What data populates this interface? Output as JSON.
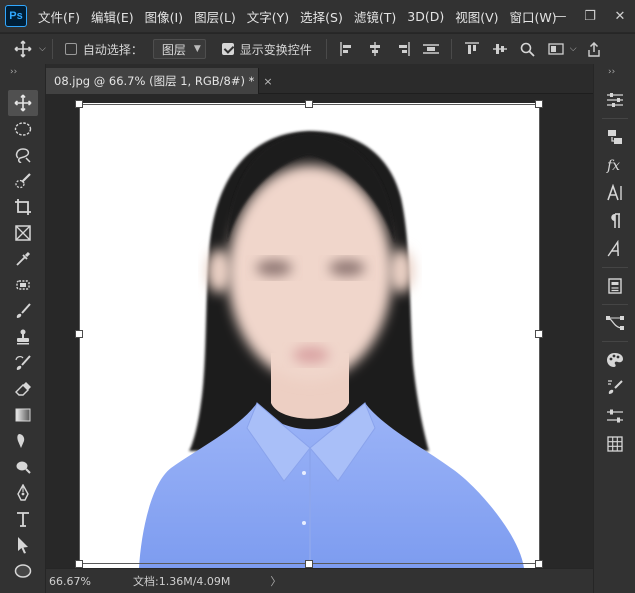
{
  "app": {
    "logo_text": "Ps"
  },
  "menu": [
    "文件(F)",
    "编辑(E)",
    "图像(I)",
    "图层(L)",
    "文字(Y)",
    "选择(S)",
    "滤镜(T)",
    "3D(D)",
    "视图(V)",
    "窗口(W)"
  ],
  "window_controls": {
    "minimize": "—",
    "restore": "❐",
    "close": "✕"
  },
  "options": {
    "auto_select_label": "自动选择：",
    "auto_select_checked": false,
    "auto_select_target": "图层",
    "show_transform_label": "显示变换控件",
    "show_transform_checked": true
  },
  "document": {
    "tab_title": "08.jpg @ 66.7% (图层 1, RGB/8#) *",
    "close_glyph": "×"
  },
  "status": {
    "zoom": "66.67%",
    "doc_info": "文档:1.36M/4.09M",
    "arrow": "〉"
  },
  "panel_strip": {
    "collapse": "››"
  },
  "colors": {
    "bg": "#282828",
    "panel": "#323232",
    "accent": "#31a8ff",
    "shirt": "#7f9ff0",
    "hair": "#1c1a1b"
  }
}
